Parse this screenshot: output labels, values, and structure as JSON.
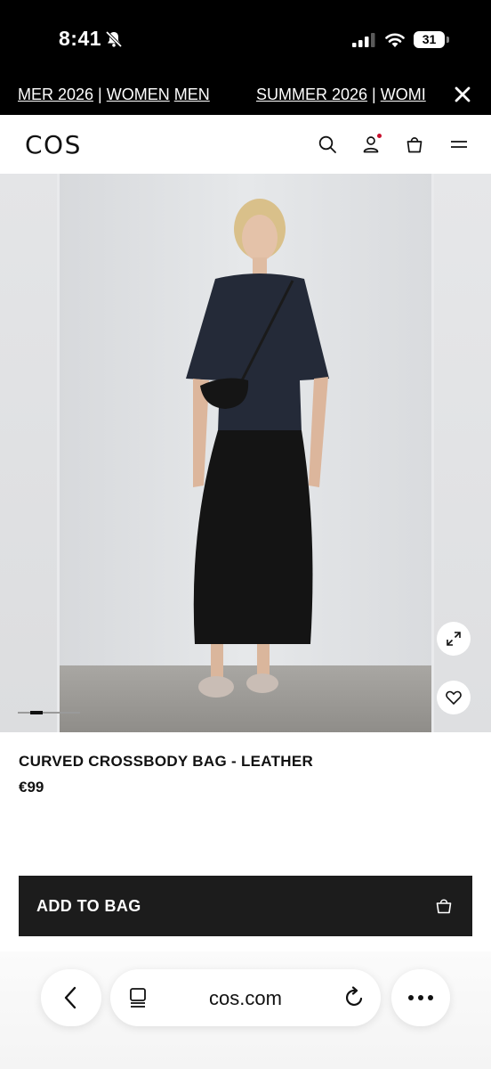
{
  "status_bar": {
    "time": "8:41",
    "battery": "31",
    "icons": [
      "bell-muted-icon",
      "signal-icon",
      "wifi-icon",
      "battery-icon"
    ]
  },
  "banner": {
    "segment1_prefix": "MER 2026",
    "segment1_sep": " | ",
    "segment1_link1": "WOMEN",
    "segment1_link2": "MEN",
    "segment2_prefix": "SUMMER 2026",
    "segment2_sep": " | ",
    "segment2_link1": "WOMI"
  },
  "header": {
    "logo": "COS",
    "icons": [
      "search-icon",
      "account-icon",
      "bag-icon",
      "menu-icon"
    ],
    "notification_color": "#c8102e"
  },
  "gallery": {
    "image_index": 2,
    "image_count": 5,
    "icons": [
      "expand-icon",
      "heart-icon"
    ]
  },
  "product": {
    "title": "CURVED CROSSBODY BAG - LEATHER",
    "price": "€99"
  },
  "cta": {
    "label": "ADD TO BAG",
    "icon": "bag-icon"
  },
  "browser": {
    "url": "cos.com",
    "icons": [
      "back-icon",
      "tabs-icon",
      "reload-icon",
      "more-icon"
    ]
  },
  "colors": {
    "accent": "#1c1c1c",
    "bar_background": "#000000"
  }
}
